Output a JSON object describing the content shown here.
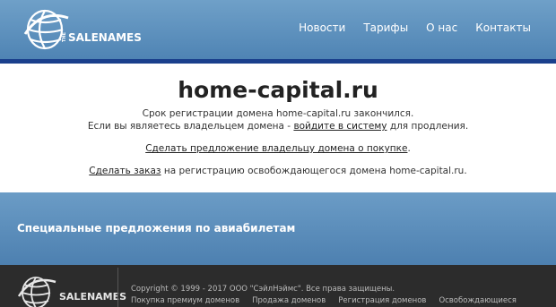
{
  "header": {
    "logo_text": "SALENAMES",
    "logo_prefix": "THE",
    "nav": [
      {
        "label": "Новости"
      },
      {
        "label": "Тарифы"
      },
      {
        "label": "О нас"
      },
      {
        "label": "Контакты"
      }
    ],
    "colors": {
      "bar": "#5b8fbe",
      "underline": "#1a3f8c"
    }
  },
  "main": {
    "domain": "home-capital.ru",
    "expired_text": "Срок регистрации домена home-capital.ru закончился.",
    "owner_prefix": "Если вы являетесь владельцем домена -",
    "login_link": "войдите в систему",
    "owner_suffix": "для продления.",
    "offer_link": "Сделать предложение владельцу домена о покупке",
    "offer_suffix": ".",
    "order_link": "Сделать заказ",
    "order_suffix": "на регистрацию освобождающегося домена home-capital.ru."
  },
  "promo": {
    "text": "Специальные предложения по авиабилетам"
  },
  "footer": {
    "logo_text": "SALENAMES",
    "copyright": "Copyright © 1999 - 2017 ООО \"СэйлНэймс\". Все права защищены.",
    "links": [
      {
        "label": "Покупка премиум доменов"
      },
      {
        "label": "Продажа доменов"
      },
      {
        "label": "Регистрация доменов"
      },
      {
        "label": "Освобождающиеся"
      }
    ]
  }
}
